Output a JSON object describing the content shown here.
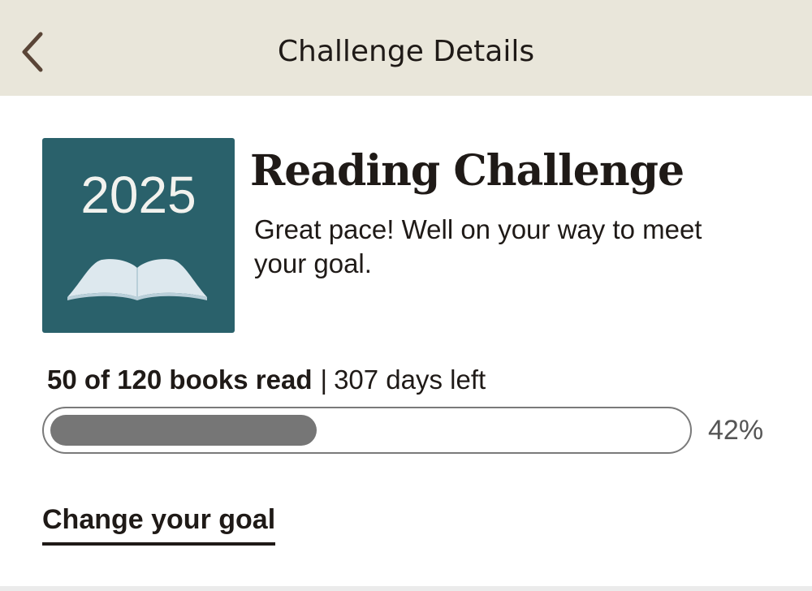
{
  "nav": {
    "back_icon": "chevron-left-icon",
    "title": "Challenge Details"
  },
  "challenge": {
    "badge_year": "2025",
    "badge_icon": "open-book-icon",
    "badge_color": "#2a616b",
    "title": "Reading Challenge",
    "subtitle": "Great pace! Well on your way to meet your goal."
  },
  "progress": {
    "books_read_text": "50 of 120 books read",
    "separator": "|",
    "days_left_text": "307 days left",
    "percent_text": "42%",
    "fraction": 0.42
  },
  "actions": {
    "change_goal_label": "Change your goal"
  },
  "colors": {
    "header_bg": "#e9e6da",
    "progress_fill": "#767676"
  }
}
